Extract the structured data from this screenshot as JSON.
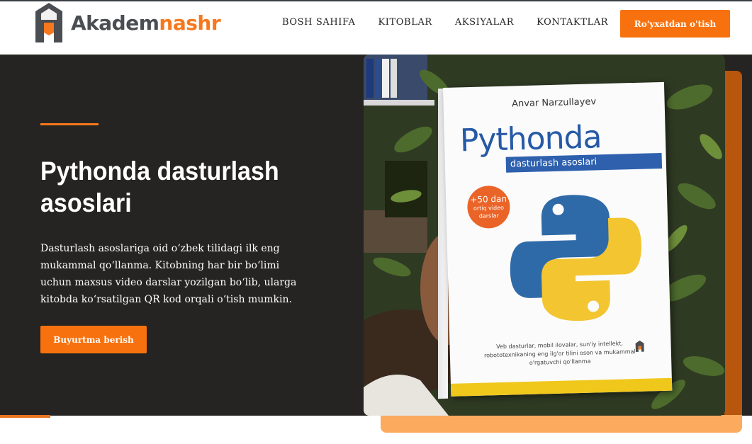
{
  "header": {
    "logo": {
      "part1": "Akadem",
      "part2": "nashr"
    },
    "nav": [
      {
        "label": "BOSH SAHIFA"
      },
      {
        "label": "KITOBLAR"
      },
      {
        "label": "AKSIYALAR"
      },
      {
        "label": "KONTAKTLAR"
      }
    ],
    "cta_label": "Ro'yxatdan o'tish"
  },
  "hero": {
    "title": "Pythonda dasturlash asoslari",
    "description": "Dasturlash asoslariga oid o‘zbek tilidagi ilk eng mukammal qo‘llanma. Kitobning har bir bo‘limi uchun maxsus video darslar yozilgan bo‘lib, ularga kitobda ko‘rsatilgan QR kod orqali o‘tish mumkin.",
    "order_label": "Buyurtma berish"
  },
  "book": {
    "author": "Anvar Narzullayev",
    "title": "Pythonda",
    "subtitle": "dasturlash asoslari",
    "badge_line1": "+50 dan",
    "badge_line2": "ortiq video",
    "badge_line3": "darslar",
    "description": "Veb dasturlar, mobil ilovalar, sun'iy intellekt, robototexnikaning eng ilg'or tilini oson va mukammal o'rgatuvchi qo'llanma"
  },
  "colors": {
    "accent": "#f7720f",
    "hero_bg": "#262422",
    "python_blue": "#2f6aa8",
    "python_yellow": "#f2c531"
  }
}
